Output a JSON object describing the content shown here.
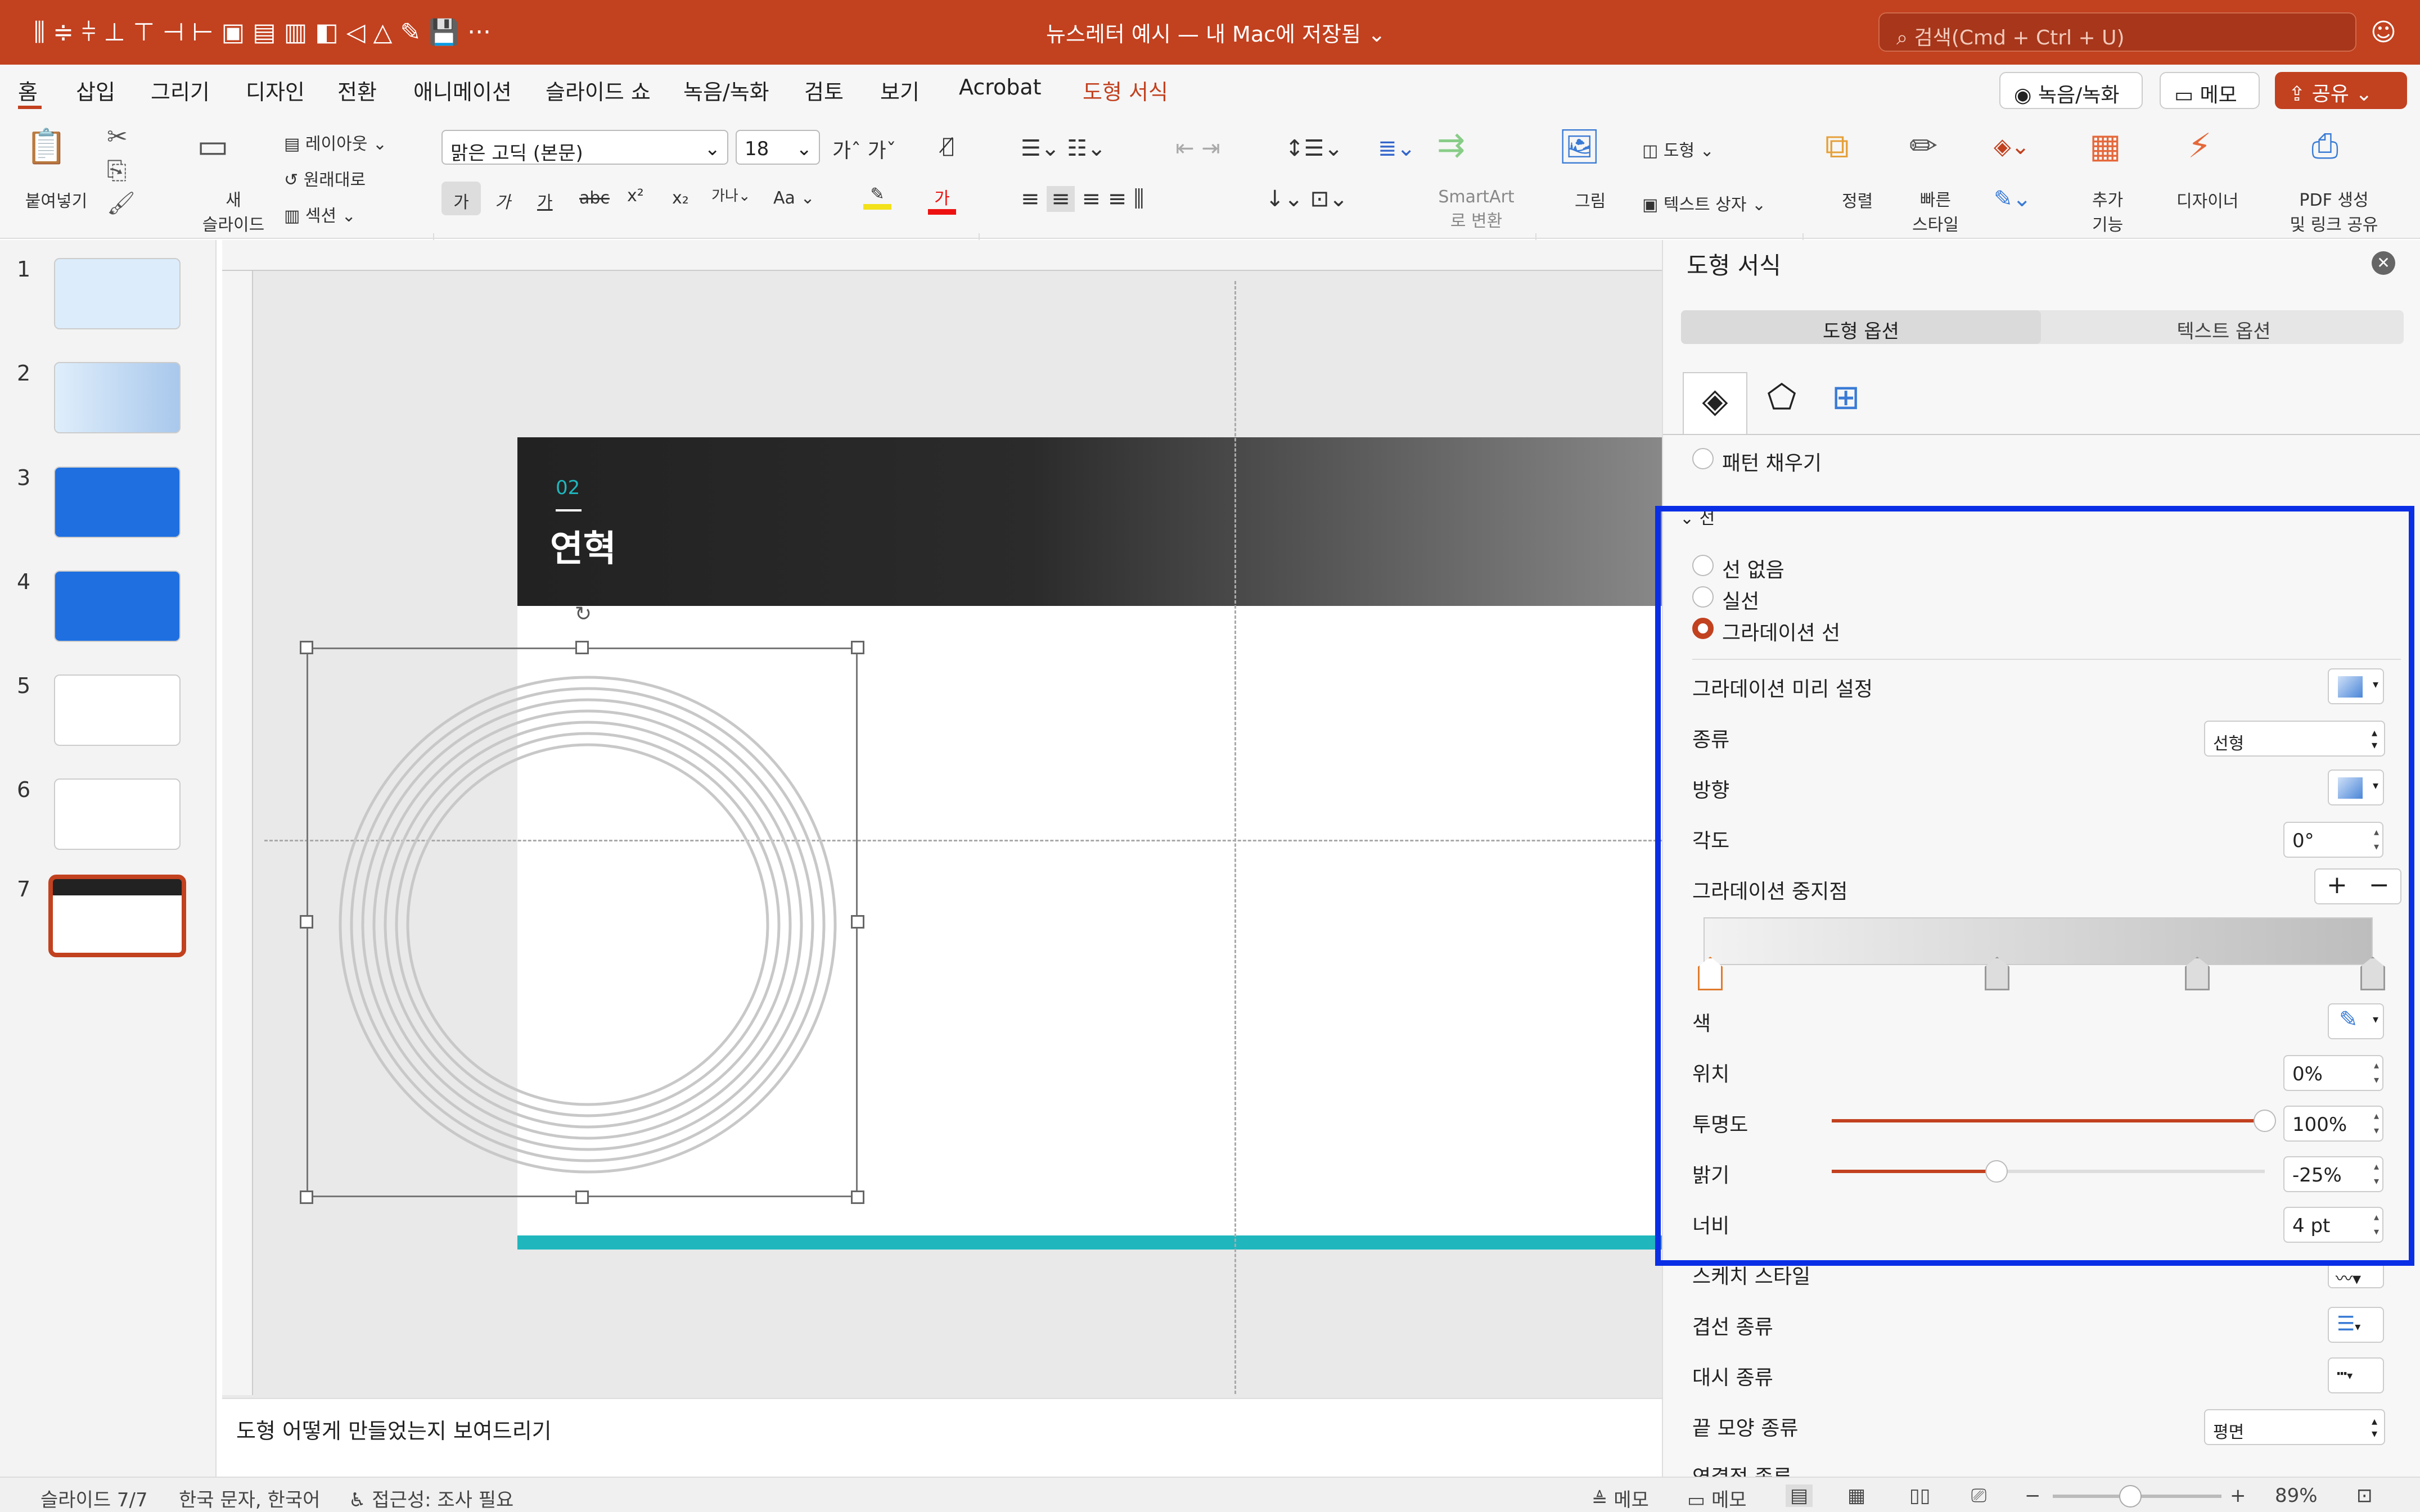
{
  "titlebar": {
    "title": "뉴스레터 예시 — 내 Mac에 저장됨",
    "search_placeholder": "검색(Cmd + Ctrl + U)"
  },
  "menu": {
    "items": [
      "홈",
      "삽입",
      "그리기",
      "디자인",
      "전환",
      "애니메이션",
      "슬라이드 쇼",
      "녹음/녹화",
      "검토",
      "보기",
      "Acrobat",
      "도형 서식"
    ],
    "record_btn": "녹음/녹화",
    "memo_btn": "메모",
    "share_btn": "공유"
  },
  "ribbon": {
    "paste": "붙여넣기",
    "new_slide_1": "새",
    "new_slide_2": "슬라이드",
    "layout": "레이아웃",
    "reset": "원래대로",
    "section": "섹션",
    "font_name": "맑은 고딕 (본문)",
    "font_size": "18",
    "bold": "가",
    "italic": "가",
    "underline": "가",
    "strike": "abc",
    "super": "x²",
    "sub": "x₂",
    "case": "Aa",
    "smartart_1": "SmartArt",
    "smartart_2": "로 변환",
    "picture": "그림",
    "shape": "도형",
    "textbox": "텍스트 상자",
    "arrange": "정렬",
    "quick_style_1": "빠른",
    "quick_style_2": "스타일",
    "addin_1": "추가",
    "addin_2": "기능",
    "designer": "디자이너",
    "pdf_1": "PDF 생성",
    "pdf_2": "및 링크 공유"
  },
  "thumbs": [
    "1",
    "2",
    "3",
    "4",
    "5",
    "6",
    "7"
  ],
  "slide": {
    "number": "02",
    "title": "연혁"
  },
  "notes": "도형 어떻게 만들었는지 보여드리기",
  "pane": {
    "title": "도형 서식",
    "tab_shape": "도형 옵션",
    "tab_text": "텍스트 옵션",
    "pattern_fill": "패턴 채우기",
    "line_section": "선",
    "no_line": "선 없음",
    "solid_line": "실선",
    "gradient_line": "그라데이션 선",
    "preset": "그라데이션 미리 설정",
    "type_label": "종류",
    "type_value": "선형",
    "direction": "방향",
    "angle_label": "각도",
    "angle_value": "0°",
    "stops": "그라데이션 중지점",
    "color": "색",
    "position_label": "위치",
    "position_value": "0%",
    "transparency_label": "투명도",
    "transparency_value": "100%",
    "transparency_fraction": 1.0,
    "brightness_label": "밝기",
    "brightness_value": "-25%",
    "brightness_fraction": 0.38,
    "width_label": "너비",
    "width_value": "4 pt",
    "sketch": "스케치 스타일",
    "compound": "겹선 종류",
    "dash": "대시 종류",
    "cap_label": "끝 모양 종류",
    "cap_value": "평면",
    "join": "연결점 종류"
  },
  "status": {
    "slide": "슬라이드 7/7",
    "lang": "한국 문자, 한국어",
    "access": "접근성: 조사 필요",
    "notes": "메모",
    "comments": "메모",
    "zoom": "89%"
  },
  "colors": {
    "accent": "#c2411f",
    "highlight": "#0a2ee6",
    "teal": "#1fb6bd"
  }
}
